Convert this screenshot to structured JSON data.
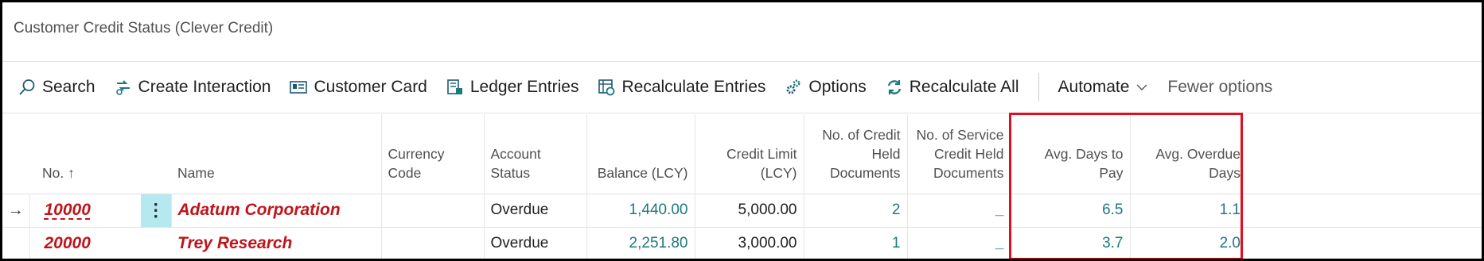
{
  "page": {
    "title": "Customer Credit Status (Clever Credit)"
  },
  "actions": [
    {
      "label": "Search",
      "icon": "search-icon"
    },
    {
      "label": "Create Interaction",
      "icon": "interaction-icon"
    },
    {
      "label": "Customer Card",
      "icon": "card-icon"
    },
    {
      "label": "Ledger Entries",
      "icon": "ledger-icon"
    },
    {
      "label": "Recalculate Entries",
      "icon": "recalculate-icon"
    },
    {
      "label": "Options",
      "icon": "gears-icon"
    },
    {
      "label": "Recalculate All",
      "icon": "refresh-icon"
    },
    {
      "label": "Automate",
      "icon": "chevron-down-icon"
    },
    {
      "label": "Fewer options"
    }
  ],
  "columns": {
    "no": "No.",
    "name": "Name",
    "currency": "Currency Code",
    "account_status_1": "Account",
    "account_status_2": "Status",
    "balance": "Balance (LCY)",
    "credit_limit_1": "Credit Limit",
    "credit_limit_2": "(LCY)",
    "credit_held_1": "No. of Credit",
    "credit_held_2": "Held",
    "credit_held_3": "Documents",
    "service_held_1": "No. of Service",
    "service_held_2": "Credit Held",
    "service_held_3": "Documents",
    "avg_days_pay": "Avg. Days to Pay",
    "avg_overdue_1": "Avg. Overdue",
    "avg_overdue_2": "Days"
  },
  "rows": [
    {
      "no": "10000",
      "name": "Adatum Corporation",
      "currency": "",
      "status": "Overdue",
      "balance": "1,440.00",
      "credit_limit": "5,000.00",
      "credit_held": "2",
      "service_held": "_",
      "avg_days_pay": "6.5",
      "avg_overdue": "1.1"
    },
    {
      "no": "20000",
      "name": "Trey Research",
      "currency": "",
      "status": "Overdue",
      "balance": "2,251.80",
      "credit_limit": "3,000.00",
      "credit_held": "1",
      "service_held": "_",
      "avg_days_pay": "3.7",
      "avg_overdue": "2.0"
    }
  ],
  "colors": {
    "accent": "#1c7980",
    "customer_text": "#c0141a",
    "highlight": "#e01020",
    "selected_cell": "#b6e8ef"
  }
}
